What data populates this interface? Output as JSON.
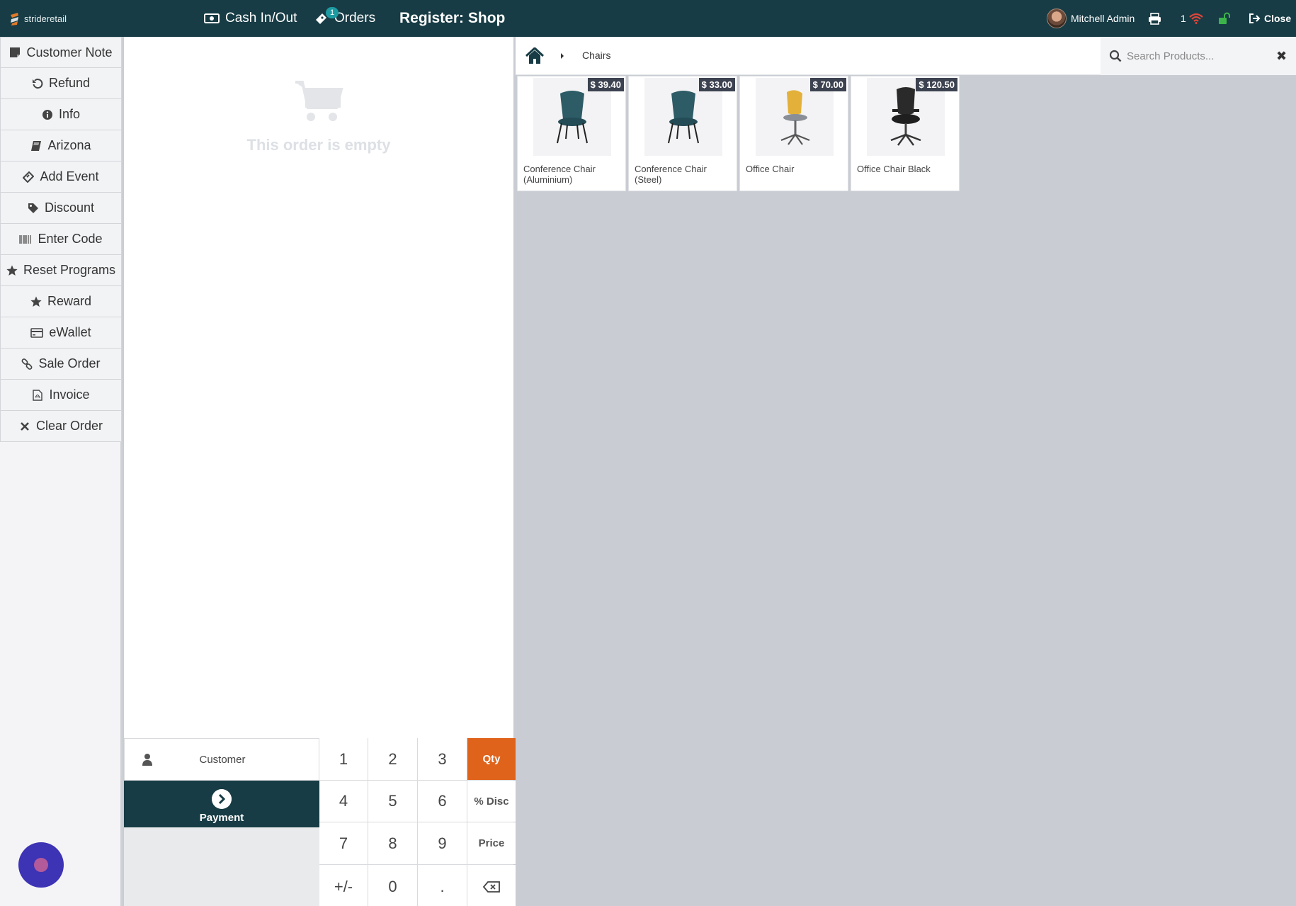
{
  "topbar": {
    "brand": "strideretail",
    "cash_label": "Cash In/Out",
    "orders_label": "Orders",
    "orders_count": "1",
    "register_label": "Register: Shop",
    "user_name": "Mitchell Admin",
    "network_count": "1",
    "close_label": "Close"
  },
  "controls": [
    {
      "label": "Customer Note",
      "icon": "note-icon"
    },
    {
      "label": "Refund",
      "icon": "undo-icon"
    },
    {
      "label": "Info",
      "icon": "info-icon"
    },
    {
      "label": "Arizona",
      "icon": "book-icon"
    },
    {
      "label": "Add Event",
      "icon": "ticket-icon"
    },
    {
      "label": "Discount",
      "icon": "tag-icon"
    },
    {
      "label": "Enter Code",
      "icon": "barcode-icon"
    },
    {
      "label": "Reset Programs",
      "icon": "star-icon"
    },
    {
      "label": "Reward",
      "icon": "star-icon"
    },
    {
      "label": "eWallet",
      "icon": "credit-card-icon"
    },
    {
      "label": "Sale Order",
      "icon": "link-icon"
    },
    {
      "label": "Invoice",
      "icon": "file-pdf-icon"
    },
    {
      "label": "Clear Order",
      "icon": "close-icon"
    }
  ],
  "order": {
    "empty_text": "This order is empty"
  },
  "actionpad": {
    "customer_label": "Customer",
    "payment_label": "Payment"
  },
  "numpad": {
    "keys": [
      "1",
      "2",
      "3",
      "Qty",
      "4",
      "5",
      "6",
      "% Disc",
      "7",
      "8",
      "9",
      "Price",
      "+/-",
      "0",
      "."
    ],
    "active_mode": "Qty",
    "active_color": "#e0631b"
  },
  "products": {
    "breadcrumb": "Chairs",
    "search_placeholder": "Search Products...",
    "items": [
      {
        "name": "Conference Chair (Aluminium)",
        "price": "$ 39.40"
      },
      {
        "name": "Conference Chair (Steel)",
        "price": "$ 33.00"
      },
      {
        "name": "Office Chair",
        "price": "$ 70.00"
      },
      {
        "name": "Office Chair Black",
        "price": "$ 120.50"
      }
    ]
  },
  "colors": {
    "header": "#173c45",
    "background": "#c9ccd3",
    "price_tag": "#3c4250"
  }
}
